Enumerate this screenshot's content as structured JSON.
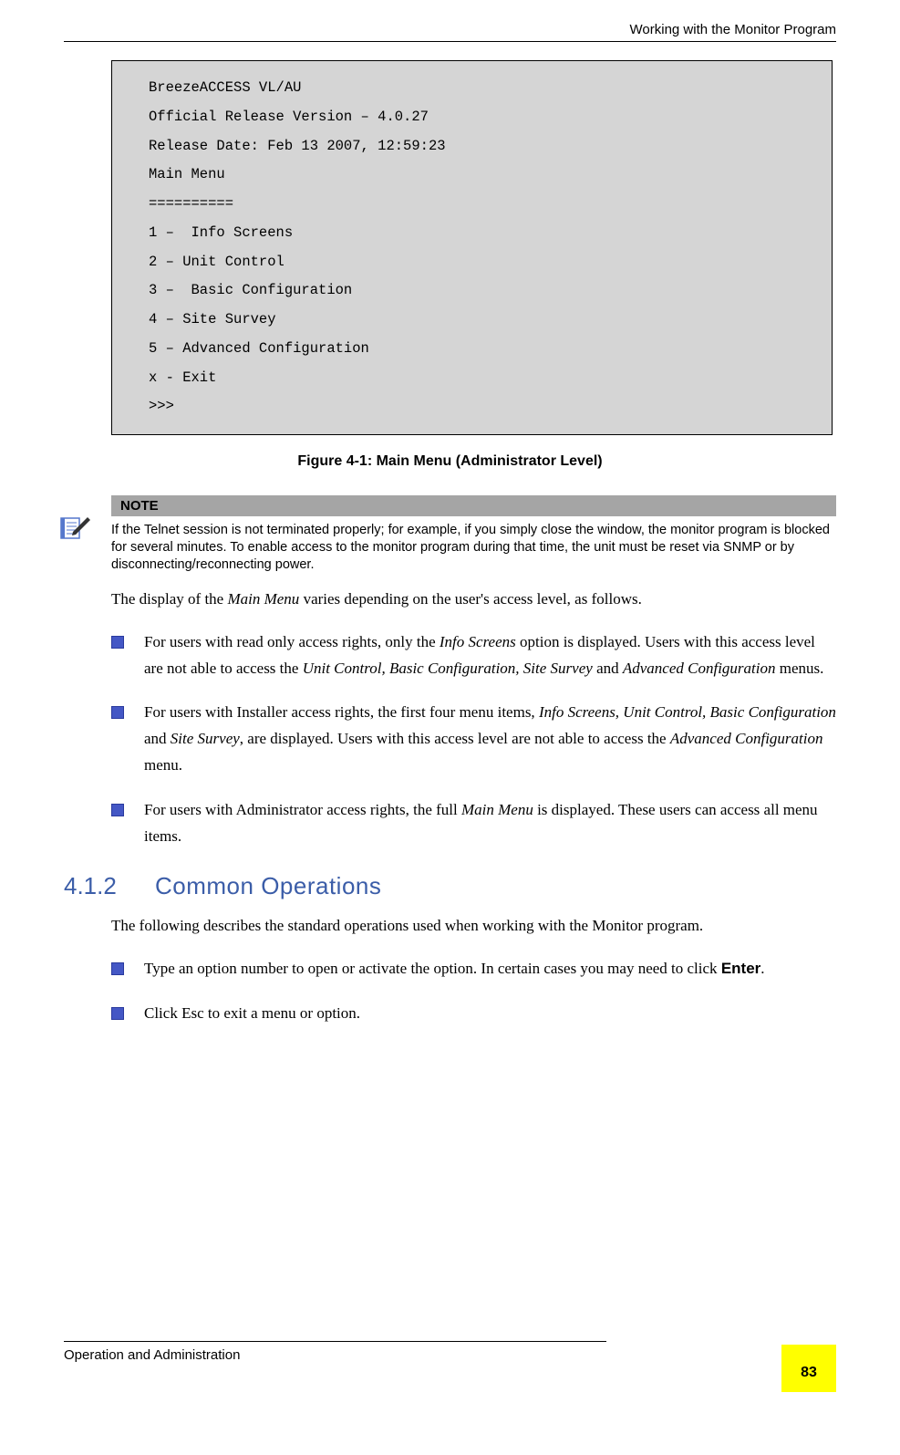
{
  "header": {
    "running_title": "Working with the Monitor Program"
  },
  "terminal": {
    "line1": "BreezeACCESS VL/AU",
    "line2": "Official Release Version – 4.0.27",
    "line3": "Release Date: Feb 13 2007, 12:59:23",
    "line4": "Main Menu",
    "line5": "==========",
    "line6": "1 –  Info Screens",
    "line7": "2 – Unit Control",
    "line8": "3 –  Basic Configuration",
    "line9": "4 – Site Survey",
    "line10": "5 – Advanced Configuration",
    "line11": "x - Exit",
    "line12": ">>>"
  },
  "figure_caption": "Figure 4-1: Main Menu (Administrator Level)",
  "note": {
    "label": "NOTE",
    "body": "If the Telnet session is not terminated properly; for example, if you simply close the window, the monitor program is blocked for several minutes. To enable access to the monitor program during that time, the unit must be reset via SNMP or by disconnecting/reconnecting power."
  },
  "para1_pre": "The display of the ",
  "para1_it": "Main Menu",
  "para1_post": " varies depending on the user's access level, as follows.",
  "b1": {
    "t1": "For users with read only access rights, only the ",
    "i1": "Info Screens",
    "t2": " option is displayed. Users with this access level are not able to access the ",
    "i2": "Unit Control, Basic Configuration, Site Survey",
    "t3": " and ",
    "i3": "Advanced Configuration",
    "t4": " menus."
  },
  "b2": {
    "t1": "For users with Installer access rights, the first four menu items, ",
    "i1": "Info Screens, Unit Control, Basic Configuration",
    "t2": " and ",
    "i2": "Site Survey",
    "t3": ", are displayed. Users with this access level are not able to access the ",
    "i3": "Advanced Configuration",
    "t4": " menu."
  },
  "b3": {
    "t1": "For users with Administrator access rights, the full ",
    "i1": "Main Menu",
    "t2": " is displayed. These users can access all menu items."
  },
  "section": {
    "num": "4.1.2",
    "title": "Common Operations"
  },
  "para2": "The following describes the standard operations used when working with the Monitor program.",
  "b4": {
    "t1": "Type an option number to open or activate the option. In certain cases you may need to click ",
    "bold": "Enter",
    "t2": "."
  },
  "b5": "Click Esc to exit a menu or option.",
  "footer": {
    "left": "Operation and Administration",
    "page": "83"
  }
}
